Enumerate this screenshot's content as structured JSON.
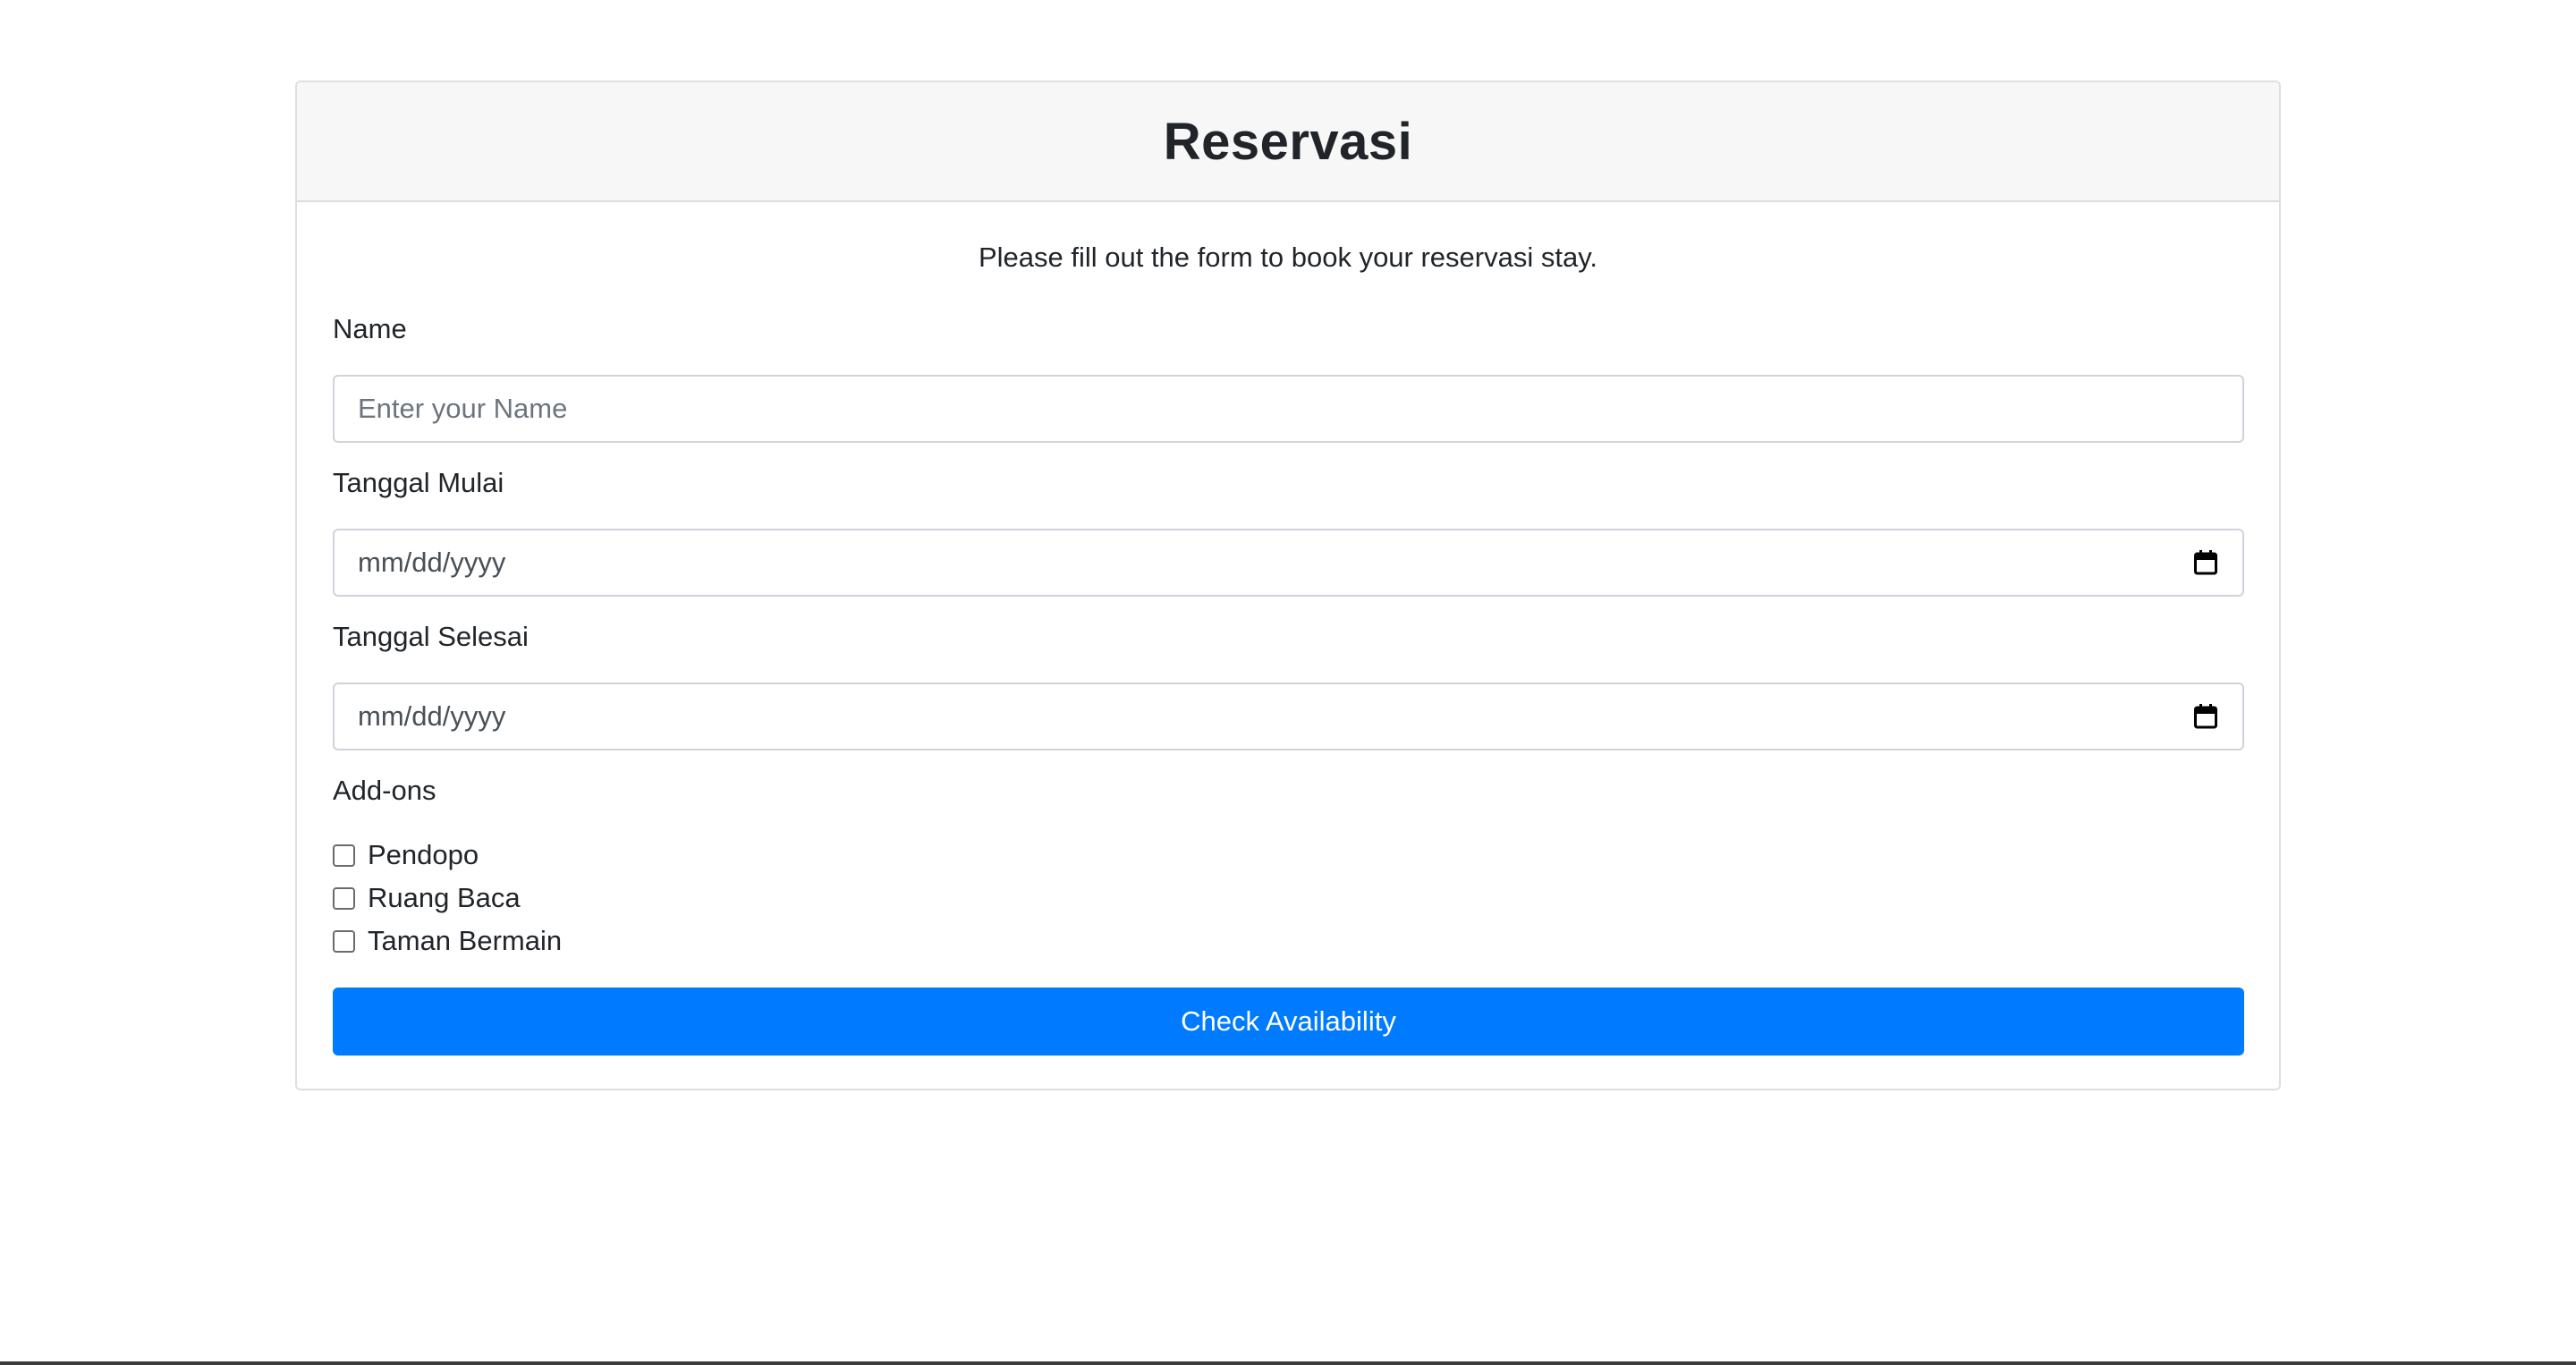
{
  "header": {
    "title": "Reservasi"
  },
  "form": {
    "intro": "Please fill out the form to book your reservasi stay.",
    "name": {
      "label": "Name",
      "placeholder": "Enter your Name",
      "value": ""
    },
    "start_date": {
      "label": "Tanggal Mulai",
      "placeholder": "mm/dd/yyyy",
      "icon": "calendar-icon"
    },
    "end_date": {
      "label": "Tanggal Selesai",
      "placeholder": "mm/dd/yyyy",
      "icon": "calendar-icon"
    },
    "addons": {
      "label": "Add-ons",
      "items": [
        {
          "label": "Pendopo",
          "checked": false
        },
        {
          "label": "Ruang Baca",
          "checked": false
        },
        {
          "label": "Taman Bermain",
          "checked": false
        }
      ]
    },
    "submit_label": "Check Availability"
  },
  "colors": {
    "primary": "#007bff",
    "header_bg": "#f7f7f7",
    "border": "#ced4da"
  }
}
